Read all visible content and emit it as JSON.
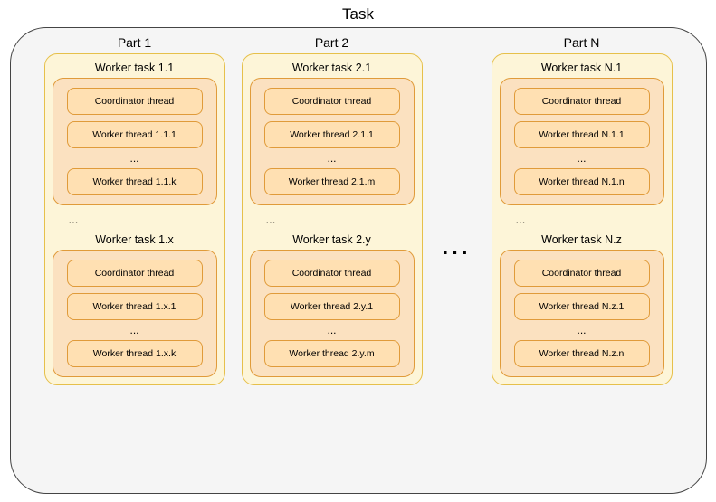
{
  "title": "Task",
  "ellipsis": "...",
  "column_ellipsis": "...",
  "parts": [
    {
      "title": "Part 1",
      "tasks": [
        {
          "title": "Worker task 1.1",
          "threads": [
            "Coordinator thread",
            "Worker thread 1.1.1",
            "...",
            "Worker thread 1.1.k"
          ]
        },
        {
          "title": "Worker task 1.x",
          "threads": [
            "Coordinator thread",
            "Worker thread 1.x.1",
            "...",
            "Worker thread 1.x.k"
          ]
        }
      ]
    },
    {
      "title": "Part 2",
      "tasks": [
        {
          "title": "Worker task 2.1",
          "threads": [
            "Coordinator thread",
            "Worker thread 2.1.1",
            "...",
            "Worker thread 2.1.m"
          ]
        },
        {
          "title": "Worker task 2.y",
          "threads": [
            "Coordinator thread",
            "Worker thread 2.y.1",
            "...",
            "Worker thread 2.y.m"
          ]
        }
      ]
    },
    {
      "title": "Part N",
      "tasks": [
        {
          "title": "Worker task N.1",
          "threads": [
            "Coordinator thread",
            "Worker thread N.1.1",
            "...",
            "Worker thread N.1.n"
          ]
        },
        {
          "title": "Worker task N.z",
          "threads": [
            "Coordinator thread",
            "Worker thread N.z.1",
            "...",
            "Worker thread N.z.n"
          ]
        }
      ]
    }
  ]
}
